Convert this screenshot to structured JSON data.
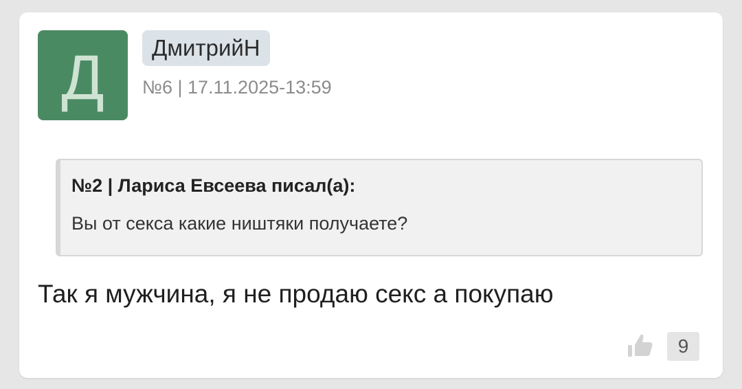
{
  "post": {
    "avatar_letter": "Д",
    "avatar_color": "#4a8a63",
    "username": "ДмитрийН",
    "meta": "№6 | 17.11.2025-13:59",
    "quote": {
      "header": "№2 | Лариса Евсеева писал(а):",
      "text": "Вы от секса какие ништяки получаете?"
    },
    "message": "Так я мужчина, я не продаю секс а покупаю",
    "likes": {
      "icon": "thumbs-up-icon",
      "count": "9"
    }
  }
}
